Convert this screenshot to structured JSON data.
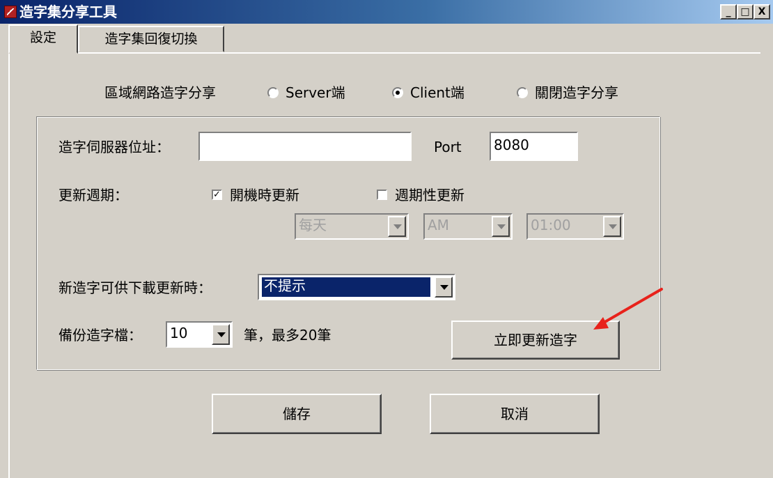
{
  "window": {
    "title": "造字集分享工具",
    "controls": {
      "minimize": "_",
      "maximize": "□",
      "close": "X"
    }
  },
  "tabs": [
    {
      "label": "設定",
      "active": true
    },
    {
      "label": "造字集回復切換",
      "active": false
    }
  ],
  "sharing": {
    "label": "區域網路造字分享",
    "options": [
      {
        "label": "Server端",
        "selected": false
      },
      {
        "label": "Client端",
        "selected": true
      },
      {
        "label": "關閉造字分享",
        "selected": false
      }
    ]
  },
  "server": {
    "address_label": "造字伺服器位址：",
    "address_value": "",
    "port_label": "Port",
    "port_value": "8080"
  },
  "update": {
    "label": "更新週期：",
    "on_boot_label": "開機時更新",
    "on_boot_checked": true,
    "periodic_label": "週期性更新",
    "periodic_checked": false,
    "frequency_value": "每天",
    "ampm_value": "AM",
    "time_value": "01:00"
  },
  "notify": {
    "label": "新造字可供下載更新時：",
    "value": "不提示"
  },
  "backup": {
    "label": "備份造字檔：",
    "value": "10",
    "suffix": "筆，最多20筆"
  },
  "buttons": {
    "update_now": "立即更新造字",
    "save": "儲存",
    "cancel": "取消"
  },
  "annotation": {
    "arrow_color": "#e8221b"
  }
}
